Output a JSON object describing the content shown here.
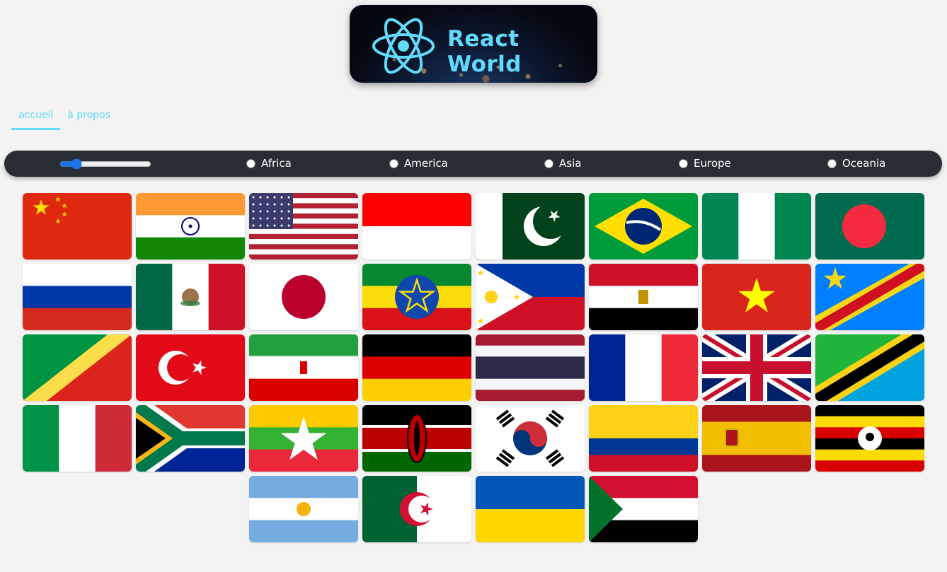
{
  "app": {
    "title": "React World"
  },
  "nav": {
    "items": [
      {
        "label": "accueil",
        "active": true
      },
      {
        "label": "à propos",
        "active": false
      }
    ]
  },
  "filters": {
    "range": {
      "min": 1,
      "max": 250,
      "value": 36
    },
    "regions": [
      "Africa",
      "America",
      "Asia",
      "Europe",
      "Oceania"
    ]
  },
  "flags": [
    "china",
    "india",
    "united-states",
    "indonesia",
    "pakistan",
    "brazil",
    "nigeria",
    "bangladesh",
    "russia",
    "mexico",
    "japan",
    "ethiopia",
    "philippines",
    "egypt",
    "vietnam",
    "dr-congo",
    "congo",
    "turkey",
    "iran",
    "germany",
    "thailand",
    "france",
    "united-kingdom",
    "tanzania",
    "italy",
    "south-africa",
    "myanmar",
    "kenya",
    "south-korea",
    "colombia",
    "spain",
    "uganda",
    "argentina",
    "algeria",
    "ukraine",
    "sudan"
  ],
  "colors": {
    "accent": "#61dafb",
    "bar": "#282c34",
    "background": "#f3f3f3"
  }
}
